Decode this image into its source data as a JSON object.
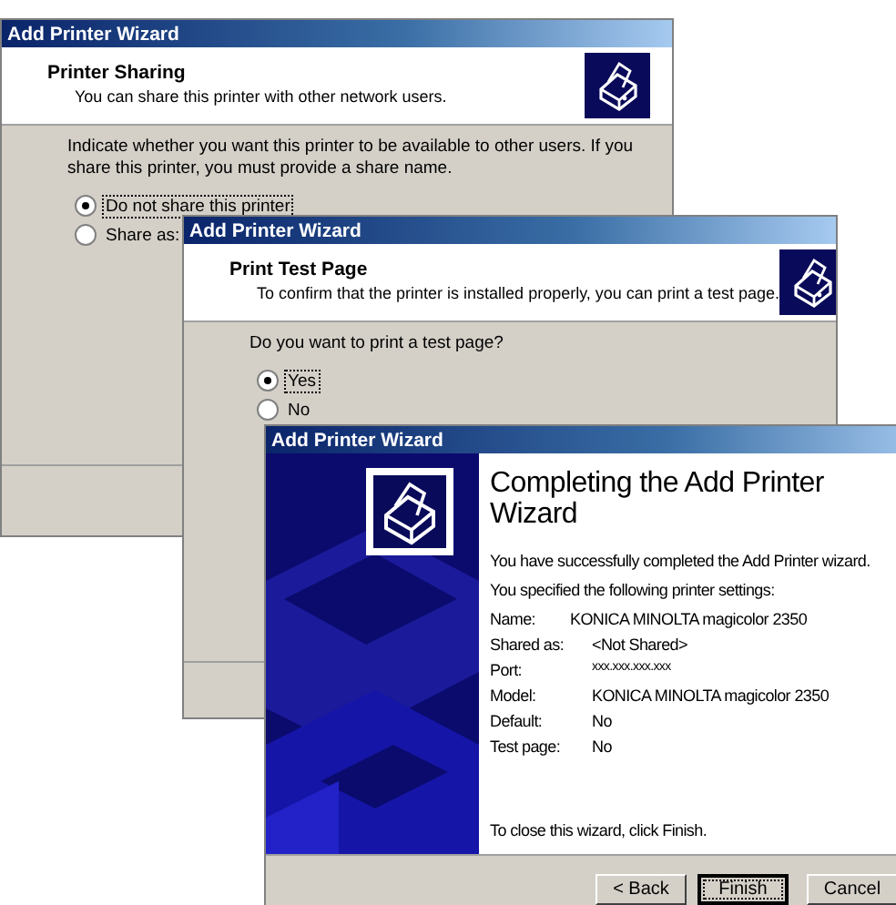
{
  "windows": [
    {
      "kind": "options",
      "title": "Add Printer Wizard",
      "heading": "Printer Sharing",
      "subtitle": "You can share this printer with other network users.",
      "prompt": "Indicate whether you want this printer to be available to other users. If you share this printer, you must provide a share name.",
      "options": [
        {
          "label": "Do not share this printer",
          "selected": true,
          "focused": true
        },
        {
          "label": "Share as:",
          "selected": false,
          "focused": false
        }
      ]
    },
    {
      "kind": "options",
      "title": "Add Printer Wizard",
      "heading": "Print Test Page",
      "subtitle": "To confirm that the printer is installed properly, you can print a test page.",
      "prompt": "Do you want to print a test page?",
      "options": [
        {
          "label": "Yes",
          "selected": true,
          "focused": true
        },
        {
          "label": "No",
          "selected": false,
          "focused": false
        }
      ]
    },
    {
      "kind": "summary",
      "title": "Add Printer Wizard",
      "heading": "Completing the Add Printer Wizard",
      "intro": "You have successfully completed the Add Printer wizard.",
      "lead": "You specified the following printer settings:",
      "settings": [
        {
          "label": "Name:",
          "value": "KONICA MINOLTA magicolor 2350"
        },
        {
          "label": "Shared as:",
          "value": "<Not Shared>"
        },
        {
          "label": "Port:",
          "value": "xxx.xxx.xxx.xxx"
        },
        {
          "label": "Model:",
          "value": "KONICA MINOLTA magicolor 2350"
        },
        {
          "label": "Default:",
          "value": "No"
        },
        {
          "label": "Test page:",
          "value": "No"
        }
      ],
      "closing": "To close this wizard, click Finish.",
      "buttons": [
        {
          "label": "< Back",
          "focused": false
        },
        {
          "label": "Finish",
          "focused": true
        },
        {
          "label": "Cancel",
          "focused": false
        }
      ]
    }
  ]
}
